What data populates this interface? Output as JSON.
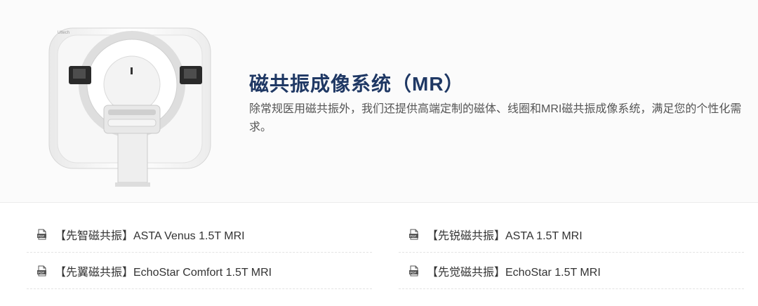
{
  "hero": {
    "brand_mark": "Ultech",
    "title": "磁共振成像系统（MR）",
    "description": "除常规医用磁共振外，我们还提供高端定制的磁体、线圈和MRI磁共振成像系统，满足您的个性化需求。"
  },
  "documents": [
    {
      "label": "【先智磁共振】ASTA Venus 1.5T MRI",
      "icon": "pdf-icon"
    },
    {
      "label": "【先锐磁共振】ASTA 1.5T MRI",
      "icon": "pdf-icon"
    },
    {
      "label": "【先翼磁共振】EchoStar Comfort 1.5T MRI",
      "icon": "pdf-icon"
    },
    {
      "label": "【先觉磁共振】EchoStar 1.5T MRI",
      "icon": "pdf-icon"
    }
  ],
  "colors": {
    "title": "#1f3864",
    "text": "#333333",
    "description": "#555555"
  }
}
